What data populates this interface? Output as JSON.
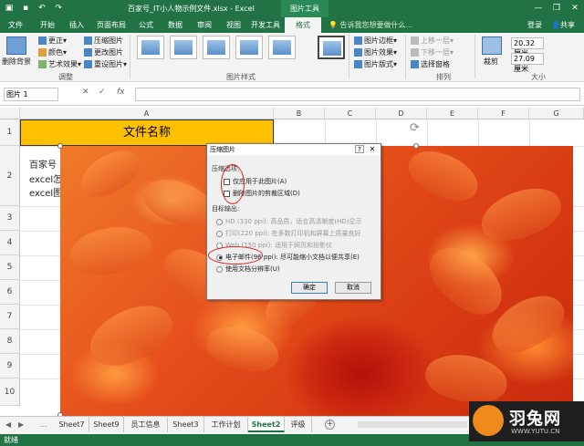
{
  "titlebar": {
    "doc_title": "百家号_IT小人物示例文件.xlsx - Excel",
    "context_title": "图片工具",
    "min": "—",
    "restore": "❐",
    "close": "✕"
  },
  "ribbon_tabs": {
    "file": "文件",
    "home": "开始",
    "insert": "插入",
    "page_layout": "页面布局",
    "formulas": "公式",
    "data": "数据",
    "review": "审阅",
    "view": "视图",
    "developer": "开发工具",
    "format": "格式",
    "tell_me": "告诉我您想要做什么...",
    "login": "登录",
    "share": "共享"
  },
  "ribbon": {
    "remove_bg": "删除背景",
    "corrections": "更正",
    "color": "颜色",
    "artistic": "艺术效果",
    "compress": "压缩图片",
    "change": "更改图片",
    "reset": "重设图片",
    "adjust_group": "调整",
    "styles_group": "图片样式",
    "border": "图片边框",
    "effects": "图片效果",
    "layout": "图片版式",
    "bring_forward": "上移一层",
    "send_backward": "下移一层",
    "selection_pane": "选择窗格",
    "arrange_group": "排列",
    "crop": "裁剪",
    "height": "20.32 厘米",
    "width": "27.09 厘米",
    "size_group": "大小"
  },
  "formula_bar": {
    "name_box": "图片 1",
    "cancel": "✕",
    "enter": "✓",
    "fx": "fx"
  },
  "grid": {
    "columns": [
      "A",
      "B",
      "C",
      "D",
      "E",
      "F",
      "G"
    ],
    "rows": [
      "1",
      "2",
      "3",
      "4",
      "5",
      "6",
      "7",
      "8",
      "9",
      "10"
    ],
    "title_cell": "文件名称",
    "a2_lines": [
      "百家号",
      "excel怎",
      "excel图"
    ]
  },
  "dialog": {
    "title": "压缩图片",
    "help": "?",
    "close": "✕",
    "compress_options": "压缩选项:",
    "apply_only": "仅应用于此图片(A)",
    "delete_cropped": "删除图片的剪裁区域(D)",
    "target_output": "目标输出:",
    "hd": "HD (330 ppi): 高品质，适合高清晰度(HD)显示",
    "print": "打印(220 ppi): 在多数打印机和屏幕上质量良好",
    "web": "Web (150 ppi): 适用于网页和投影仪",
    "email": "电子邮件(96 ppi): 尽可能缩小文档以便共享(E)",
    "doc_res": "使用文档分辨率(U)",
    "ok": "确定",
    "cancel": "取消"
  },
  "sheets": {
    "nav_prev": "◀",
    "nav_next": "▶",
    "more": "...",
    "tabs": [
      "Sheet7",
      "Sheet9",
      "员工信息",
      "Sheet3",
      "工作计划",
      "Sheet2",
      "评级"
    ],
    "active": "Sheet2",
    "add": "+"
  },
  "status": {
    "ready": "就绪"
  },
  "watermark": {
    "name": "羽兔网",
    "url": "WWW.YUTU.CN"
  }
}
